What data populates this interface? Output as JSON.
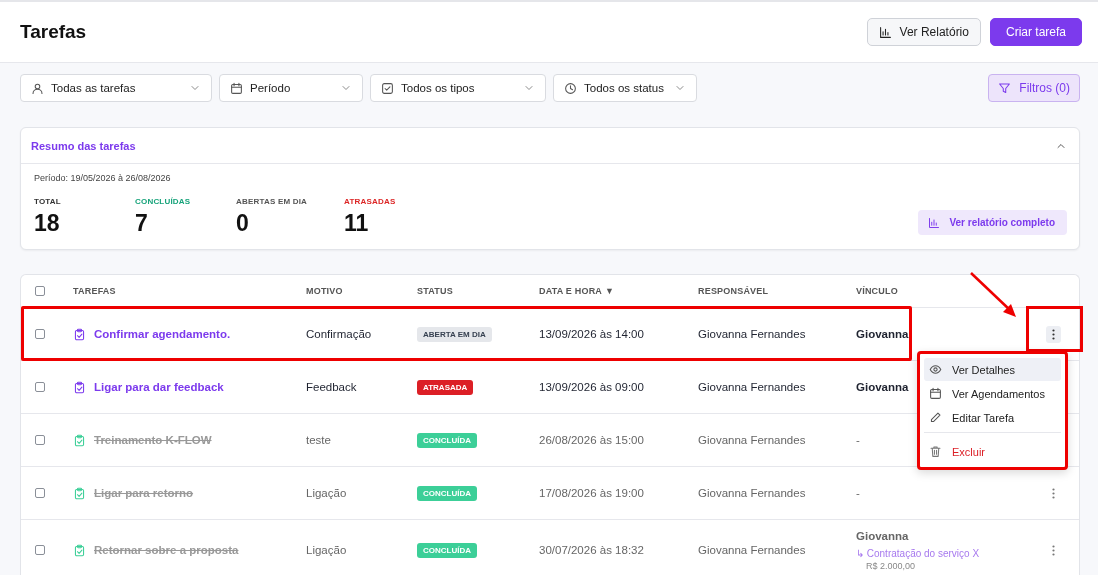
{
  "header": {
    "title": "Tarefas",
    "buttons": [
      {
        "label": "Ver Relatório",
        "kind": "secondary"
      },
      {
        "label": "Criar tarefa",
        "kind": "primary"
      }
    ]
  },
  "filters": [
    {
      "label": "Todas as tarefas"
    },
    {
      "label": "Período"
    },
    {
      "label": "Todos os tipos"
    },
    {
      "label": "Todos os status"
    }
  ],
  "filter_button": {
    "label": "Filtros (0)"
  },
  "summary": {
    "title": "Resumo das tarefas",
    "expanded": true,
    "period": "Período: 19/05/2026 à 26/08/2026",
    "report_button": "Ver relatório completo",
    "stats": [
      {
        "label": "TOTAL",
        "value": "18",
        "color": "#333333"
      },
      {
        "label": "CONCLUÍDAS",
        "value": "7",
        "color": "#16a37a"
      },
      {
        "label": "ABERTAS EM DIA",
        "value": "0",
        "color": "#555555"
      },
      {
        "label": "ATRASADAS",
        "value": "11",
        "color": "#dc2626"
      }
    ]
  },
  "table": {
    "columns": [
      "TAREFAS",
      "MOTIVO",
      "STATUS",
      "DATA E HORA",
      "RESPONSÁVEL",
      "VÍNCULO"
    ],
    "sort_mark": "▼",
    "select_all_checked": false,
    "rows": [
      {
        "checked": false,
        "done": false,
        "framed": true,
        "task": "Confirmar agendamento.",
        "reason": "Confirmação",
        "status": {
          "label": "ABERTA EM DIA",
          "kind": "open"
        },
        "datetime": "13/09/2026 às 14:00",
        "owner": "Giovanna Fernandes",
        "link": "Giovanna",
        "menu_open": true
      },
      {
        "checked": false,
        "done": false,
        "framed": false,
        "task": "Ligar para dar feedback",
        "reason": "Feedback",
        "status": {
          "label": "ATRASADA",
          "kind": "late"
        },
        "datetime": "13/09/2026 às 09:00",
        "owner": "Giovanna Fernandes",
        "link": "Giovanna",
        "menu_open": false
      },
      {
        "checked": false,
        "done": true,
        "framed": false,
        "task": "Treinamento K-FLOW",
        "reason": "teste",
        "status": {
          "label": "CONCLUÍDA",
          "kind": "done"
        },
        "datetime": "26/08/2026 às 15:00",
        "owner": "Giovanna Fernandes",
        "link": "-",
        "menu_open": false
      },
      {
        "checked": false,
        "done": true,
        "framed": false,
        "task": "Ligar para retorno",
        "reason": "Ligação",
        "status": {
          "label": "CONCLUÍDA",
          "kind": "done"
        },
        "datetime": "17/08/2026 às 19:00",
        "owner": "Giovanna Fernandes",
        "link": "-",
        "menu_open": false
      },
      {
        "checked": false,
        "done": true,
        "framed": false,
        "task": "Retornar sobre a proposta",
        "reason": "Ligação",
        "status": {
          "label": "CONCLUÍDA",
          "kind": "done"
        },
        "datetime": "30/07/2026 às 18:32",
        "owner": "Giovanna Fernandes",
        "link": "Giovanna",
        "link_detail": "↳ Contratação do serviço X",
        "link_amount": "R$ 2.000,00",
        "menu_open": false
      }
    ]
  },
  "menu": {
    "framed": true,
    "items": [
      {
        "label": "Ver Detalhes",
        "kind": "normal",
        "hovered": true
      },
      {
        "label": "Ver Agendamentos",
        "kind": "normal",
        "hovered": false
      },
      {
        "label": "Editar Tarefa",
        "kind": "normal",
        "hovered": false
      },
      {
        "label": "Excluir",
        "kind": "danger",
        "hovered": false
      }
    ]
  },
  "annotations": [
    {
      "kind": "arrow"
    }
  ]
}
